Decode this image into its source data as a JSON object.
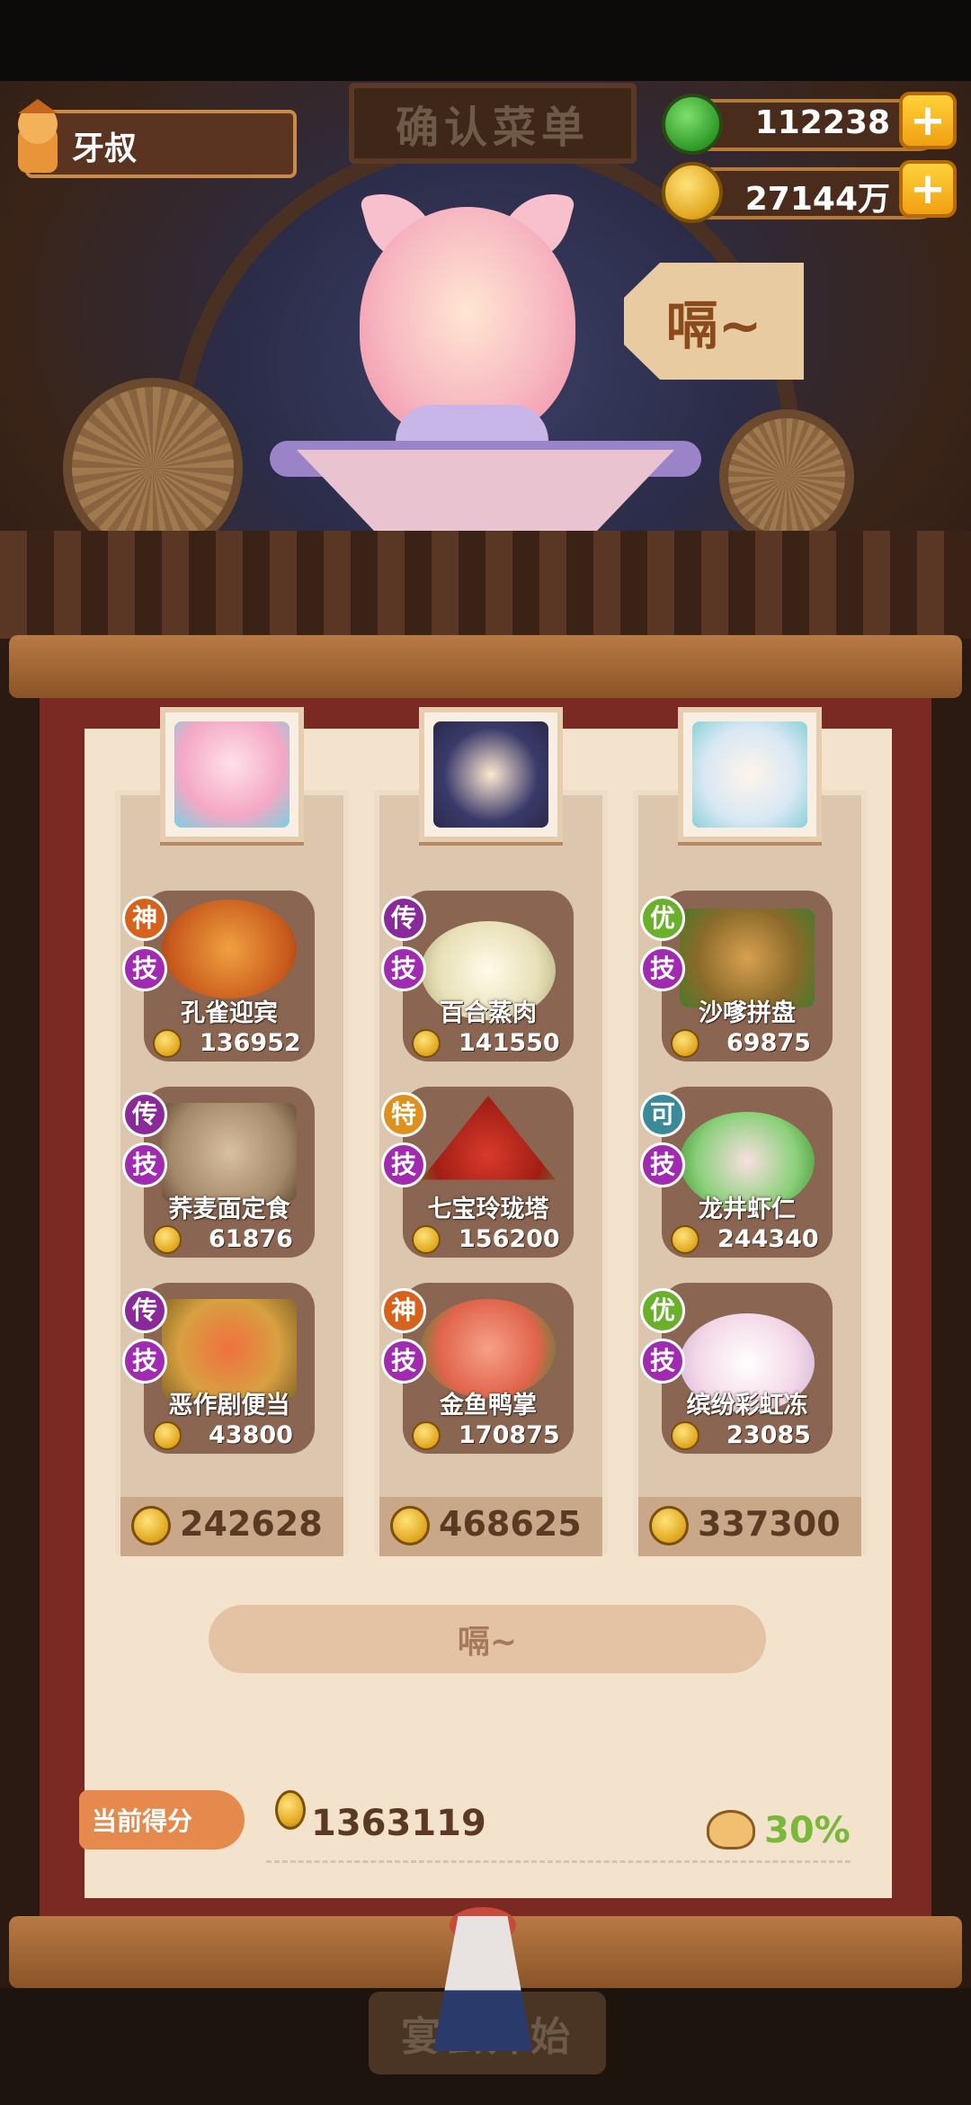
{
  "player": {
    "name": "牙叔"
  },
  "header": {
    "title": "确认菜单"
  },
  "currency": {
    "jade": {
      "value": "112238",
      "icon": "jade-icon",
      "plus": "+"
    },
    "coins": {
      "value": "27144万",
      "icon": "coin-icon",
      "plus": "+"
    }
  },
  "customer": {
    "speech": "嗝~"
  },
  "columns": [
    {
      "chef": "chef-portrait",
      "total": "242628",
      "dishes": [
        {
          "name": "孔雀迎宾",
          "price": "136952",
          "rank": "神",
          "rank_color": "#d8621c",
          "skill": "技"
        },
        {
          "name": "荞麦面定食",
          "price": "61876",
          "rank": "传",
          "rank_color": "#8a2a9a",
          "skill": "技"
        },
        {
          "name": "恶作剧便当",
          "price": "43800",
          "rank": "传",
          "rank_color": "#8a2a9a",
          "skill": "技"
        }
      ]
    },
    {
      "chef": "chef-portrait",
      "total": "468625",
      "dishes": [
        {
          "name": "百合蒸肉",
          "price": "141550",
          "rank": "传",
          "rank_color": "#8a2a9a",
          "skill": "技"
        },
        {
          "name": "七宝玲珑塔",
          "price": "156200",
          "rank": "特",
          "rank_color": "#e0901c",
          "skill": "技"
        },
        {
          "name": "金鱼鸭掌",
          "price": "170875",
          "rank": "神",
          "rank_color": "#d8621c",
          "skill": "技"
        }
      ]
    },
    {
      "chef": "chef-portrait",
      "total": "337300",
      "dishes": [
        {
          "name": "沙嗲拼盘",
          "price": "69875",
          "rank": "优",
          "rank_color": "#6ab02a",
          "skill": "技"
        },
        {
          "name": "龙井虾仁",
          "price": "244340",
          "rank": "可",
          "rank_color": "#3a8a9a",
          "skill": "技"
        },
        {
          "name": "缤纷彩虹冻",
          "price": "23085",
          "rank": "优",
          "rank_color": "#6ab02a",
          "skill": "技"
        }
      ]
    }
  ],
  "action_button": {
    "label": "嗝~"
  },
  "score": {
    "label": "当前得分",
    "value": "1363119",
    "bonus": "30%"
  },
  "start_button": {
    "label": "宴会开始"
  }
}
